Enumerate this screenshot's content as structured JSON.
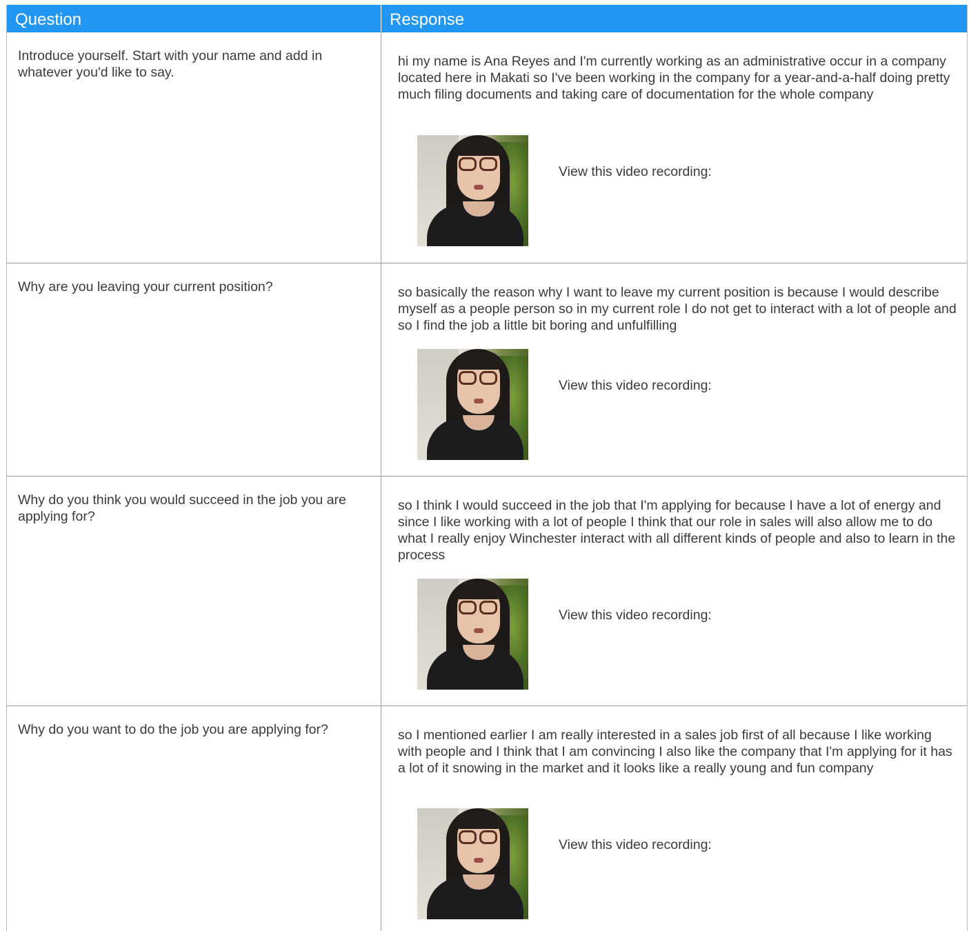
{
  "header": {
    "question_label": "Question",
    "response_label": "Response"
  },
  "colors": {
    "header_bg": "#2196f3",
    "header_text": "#ffffff",
    "border": "#9a9a9a"
  },
  "rows": [
    {
      "question": "Introduce yourself. Start with your name and add in whatever you'd like to say.",
      "response": "hi my name is Ana Reyes and I'm currently working as an administrative occur in a company located here in Makati so I've been working in the company for a year-and-a-half doing pretty much filing documents and taking care of documentation for the whole company",
      "video_label": "View this video recording:"
    },
    {
      "question": "Why are you leaving your current position?",
      "response": "so basically the reason why I want to leave my current position is because I would describe myself as a people person so in my current role I do not get to interact with a lot of people and so I find the job a little bit boring and unfulfilling",
      "video_label": "View this video recording:"
    },
    {
      "question": "Why do you think you would succeed in the job you are applying for?",
      "response": "so I think I would succeed in the job that I'm applying for because I have a lot of energy and since I like working with a lot of people I think that our role in sales will also allow me to do what I really enjoy Winchester interact with all different kinds of people and also to learn in the process",
      "video_label": "View this video recording:"
    },
    {
      "question": "Why do you want to do the job you are applying for?",
      "response": "so I mentioned earlier I am really interested in a sales job first of all because I like working with people and I think that I am convincing I also like the company that I'm applying for it has a lot of it snowing in the market and it looks like a really young and fun company",
      "video_label": "View this video recording:"
    }
  ]
}
